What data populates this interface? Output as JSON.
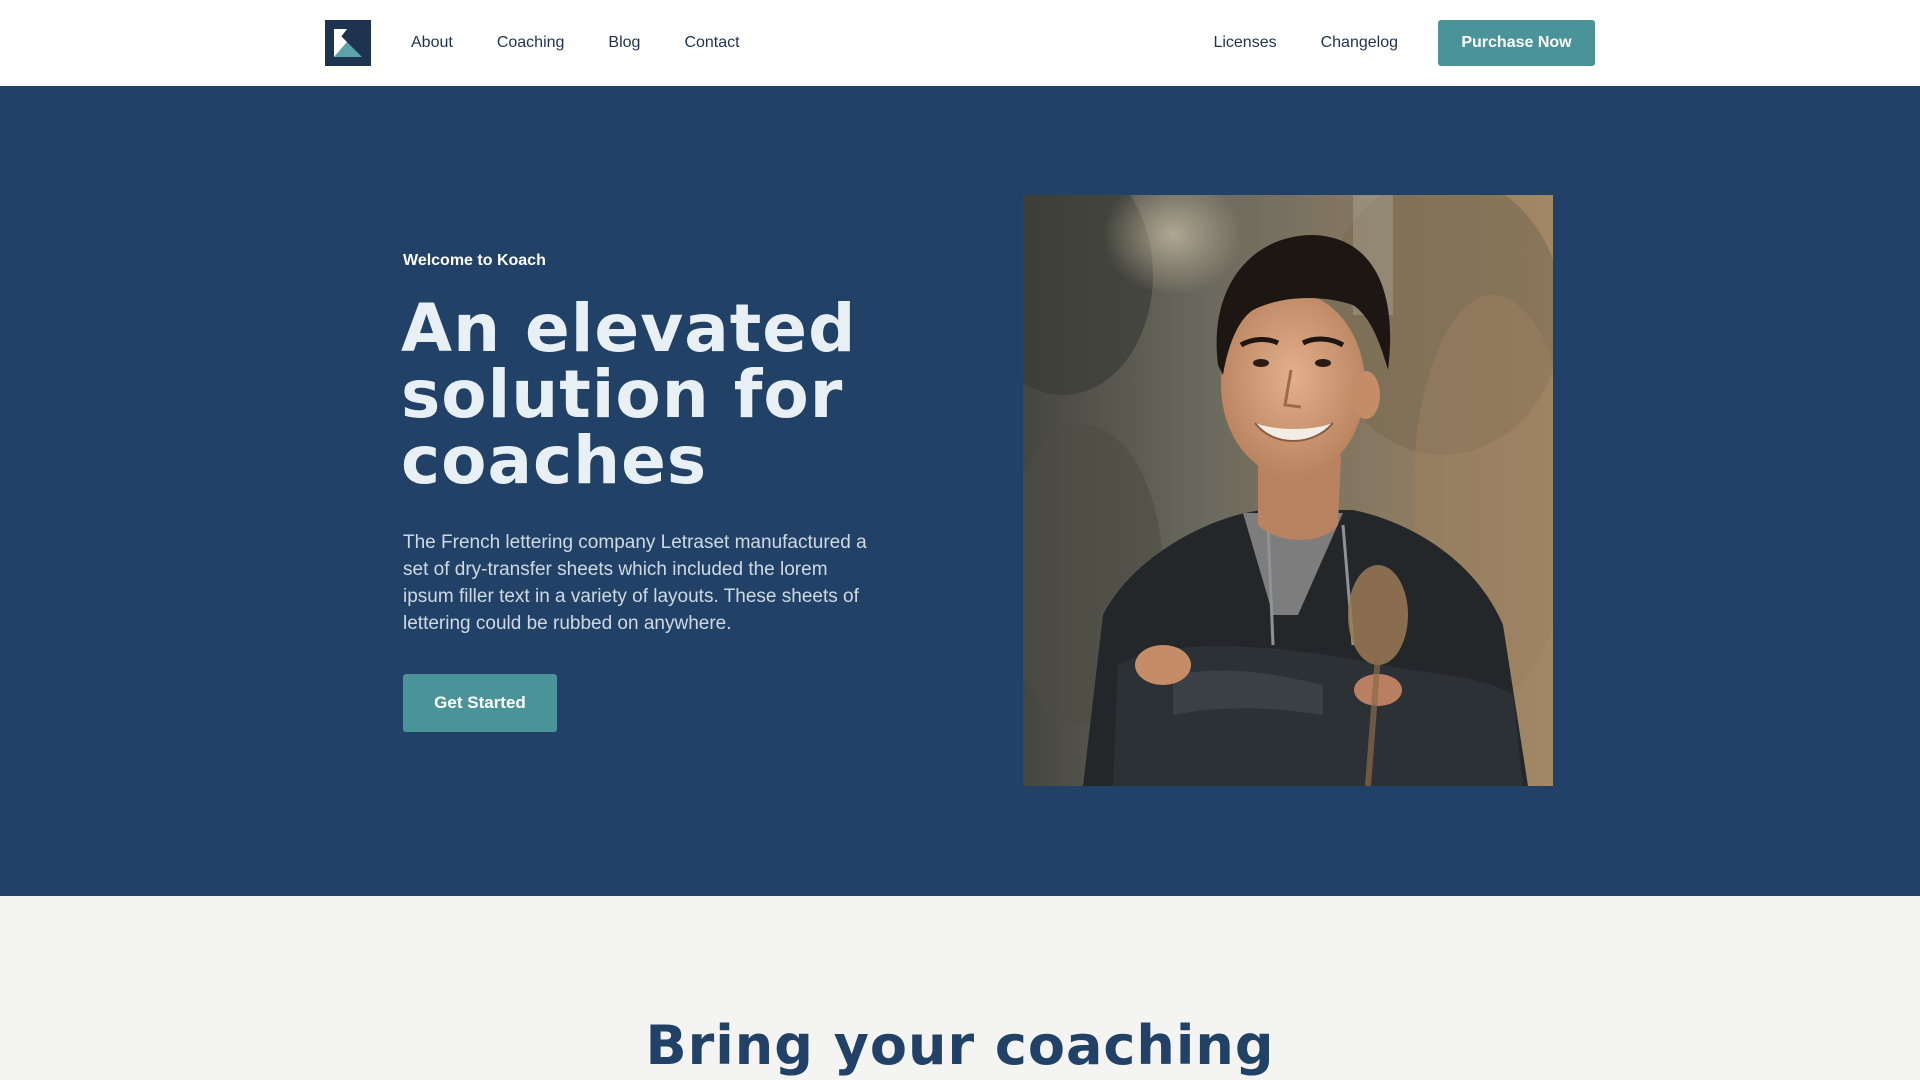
{
  "nav": {
    "left_links": [
      "About",
      "Coaching",
      "Blog",
      "Contact"
    ],
    "right_links": [
      "Licenses",
      "Changelog"
    ],
    "purchase_label": "Purchase Now",
    "logo_icon": "k-logo-icon"
  },
  "hero": {
    "eyebrow": "Welcome to Koach",
    "headline": "An elevated solution for coaches",
    "description": "The French lettering company Letraset manufactured a set of dry-transfer sheets which included the lorem ipsum filler text in a variety of layouts. These sheets of lettering could be rubbed on anywhere.",
    "cta_label": "Get Started"
  },
  "section2": {
    "title": "Bring your coaching"
  },
  "colors": {
    "navy": "#214266",
    "teal": "#4a9499",
    "nav_text": "#1e3350",
    "background": "#f4f4f2"
  }
}
